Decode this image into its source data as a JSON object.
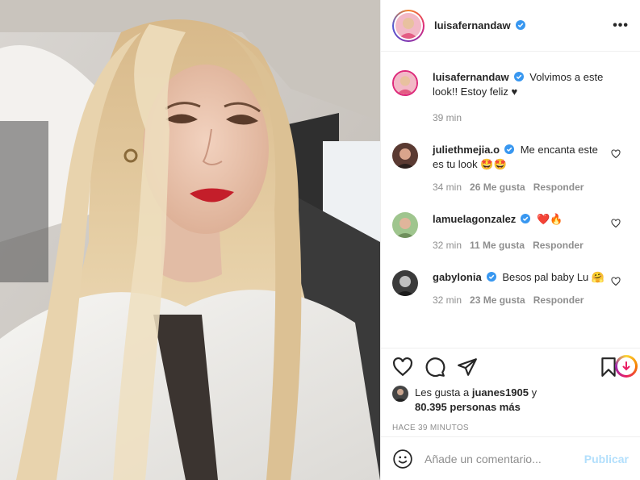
{
  "post": {
    "author": "luisafernandaw",
    "more_label": "•••"
  },
  "caption": {
    "user": "luisafernandaw",
    "text": "Volvimos a este look!! Estoy feliz ♥",
    "time": "39 min"
  },
  "comments": [
    {
      "user": "juliethmejia.o",
      "text": "Me encanta este es tu look 🤩🤩",
      "time": "34 min",
      "likes": "26 Me gusta",
      "reply": "Responder"
    },
    {
      "user": "lamuelagonzalez",
      "text": "❤️🔥",
      "time": "32 min",
      "likes": "11 Me gusta",
      "reply": "Responder"
    },
    {
      "user": "gabylonia",
      "text": "Besos pal baby Lu 🤗",
      "time": "32 min",
      "likes": "23 Me gusta",
      "reply": "Responder"
    }
  ],
  "likes": {
    "prefix": "Les gusta a",
    "user": "juanes1905",
    "suffix": "y",
    "others": "80.395 personas más"
  },
  "timestamp": "HACE 39 MINUTOS",
  "composer": {
    "placeholder": "Añade un comentario...",
    "publish_label": "Publicar"
  },
  "colors": {
    "verified": "#3897f0",
    "muted": "#8e8e8e",
    "text": "#262626",
    "publish_disabled": "#b2dffc",
    "border": "#efefef"
  },
  "icons": [
    "verified-icon",
    "more-icon",
    "heart-icon",
    "comment-icon",
    "share-icon",
    "bookmark-icon",
    "emoji-icon",
    "gift-share-icon"
  ]
}
